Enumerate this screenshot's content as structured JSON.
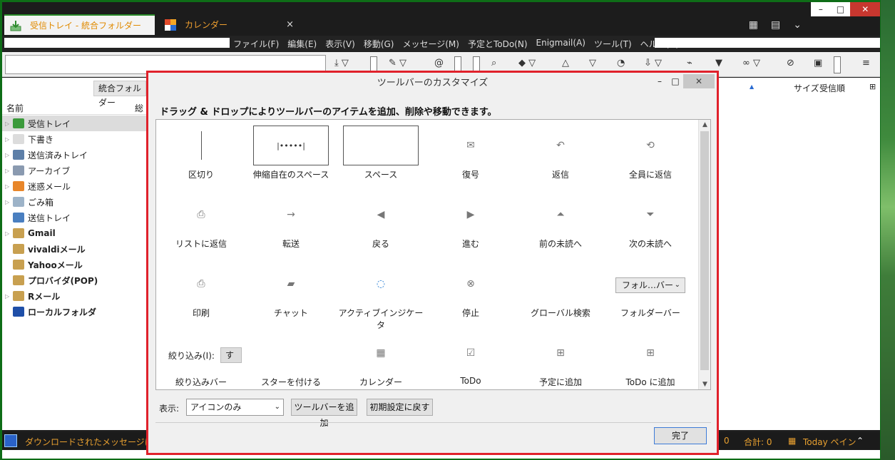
{
  "tabs": [
    {
      "label": "受信トレイ - 統合フォルダー",
      "icon": "inbox-download-icon"
    },
    {
      "label": "カレンダー",
      "icon": "calendar-icon"
    }
  ],
  "tab_close": "×",
  "window_controls": {
    "minimize": "–",
    "maximize": "□",
    "close": "✕"
  },
  "menus": [
    "ファイル(F)",
    "編集(E)",
    "表示(V)",
    "移動(G)",
    "メッセージ(M)",
    "予定とToDo(N)",
    "Enigmail(A)",
    "ツール(T)",
    "ヘルプ(H)"
  ],
  "left_pane": {
    "unified_button": "統合フォルダー",
    "col_name": "名前",
    "col_total": "総数",
    "folders": [
      {
        "label": "受信トレイ",
        "icon": "inbox-icon",
        "color": "#3b9a3b",
        "bold": false,
        "selected": true,
        "twisty": "▷"
      },
      {
        "label": "下書き",
        "icon": "draft-icon",
        "color": "#dcdcdc",
        "bold": false,
        "selected": false,
        "twisty": "▷"
      },
      {
        "label": "送信済みトレイ",
        "icon": "sent-icon",
        "color": "#5d7fa8",
        "bold": false,
        "selected": false,
        "twisty": "▷"
      },
      {
        "label": "アーカイブ",
        "icon": "archive-icon",
        "color": "#8a9ab0",
        "bold": false,
        "selected": false,
        "twisty": "▷"
      },
      {
        "label": "迷惑メール",
        "icon": "junk-icon",
        "color": "#e8862a",
        "bold": false,
        "selected": false,
        "twisty": "▷"
      },
      {
        "label": "ごみ箱",
        "icon": "trash-icon",
        "color": "#9db3c8",
        "bold": false,
        "selected": false,
        "twisty": "▷"
      },
      {
        "label": "送信トレイ",
        "icon": "outbox-icon",
        "color": "#4a7fc0",
        "bold": false,
        "selected": false,
        "twisty": ""
      },
      {
        "label": "Gmail",
        "icon": "account-icon",
        "color": "#c8a050",
        "bold": true,
        "selected": false,
        "twisty": "▷"
      },
      {
        "label": "vivaldiメール",
        "icon": "account-icon",
        "color": "#c8a050",
        "bold": true,
        "selected": false,
        "twisty": ""
      },
      {
        "label": "Yahooメール",
        "icon": "account-icon",
        "color": "#c8a050",
        "bold": true,
        "selected": false,
        "twisty": ""
      },
      {
        "label": "プロバイダ(POP)",
        "icon": "account-icon",
        "color": "#c8a050",
        "bold": true,
        "selected": false,
        "twisty": ""
      },
      {
        "label": "Rメール",
        "icon": "account-icon",
        "color": "#c8a050",
        "bold": true,
        "selected": false,
        "twisty": "▷"
      },
      {
        "label": "ローカルフォルダ",
        "icon": "local-folders-icon",
        "color": "#1f4fa8",
        "bold": true,
        "selected": false,
        "twisty": ""
      }
    ]
  },
  "right_header": {
    "sort_arrow": "▲",
    "size": "サイズ",
    "received_order": "受信順"
  },
  "dialog": {
    "title": "ツールバーのカスタマイズ",
    "instructions": "ドラッグ & ドロップによりツールバーのアイテムを追加、削除や移動できます。",
    "items": [
      {
        "label": "区切り",
        "icon": "separator-icon",
        "glyph": ""
      },
      {
        "label": "伸縮自在のスペース",
        "icon": "flexible-space-icon",
        "glyph": "|•••••|"
      },
      {
        "label": "スペース",
        "icon": "space-icon",
        "glyph": ""
      },
      {
        "label": "復号",
        "icon": "decrypt-icon",
        "glyph": "✉"
      },
      {
        "label": "返信",
        "icon": "reply-icon",
        "glyph": "↶"
      },
      {
        "label": "全員に返信",
        "icon": "reply-all-icon",
        "glyph": "⟲"
      },
      {
        "label": "リストに返信",
        "icon": "reply-list-icon",
        "glyph": "⎙"
      },
      {
        "label": "転送",
        "icon": "forward-icon",
        "glyph": "→"
      },
      {
        "label": "戻る",
        "icon": "back-icon",
        "glyph": "◀"
      },
      {
        "label": "進む",
        "icon": "forward-nav-icon",
        "glyph": "▶"
      },
      {
        "label": "前の未読へ",
        "icon": "previous-unread-icon",
        "glyph": "⏶"
      },
      {
        "label": "次の未読へ",
        "icon": "next-unread-icon",
        "glyph": "⏷"
      },
      {
        "label": "印刷",
        "icon": "print-icon",
        "glyph": "⎙"
      },
      {
        "label": "チャット",
        "icon": "chat-icon",
        "glyph": "▰"
      },
      {
        "label": "アクティブインジケータ",
        "icon": "activity-indicator-icon",
        "glyph": "◌"
      },
      {
        "label": "停止",
        "icon": "stop-icon",
        "glyph": "⊗"
      },
      {
        "label": "グローバル検索",
        "icon": "global-search-icon",
        "glyph": ""
      },
      {
        "label": "フォルダーバー",
        "icon": "folder-bar-icon",
        "glyph": ""
      },
      {
        "label": "絞り込みバー",
        "icon": "filter-bar-icon",
        "glyph": ""
      },
      {
        "label": "スターを付ける",
        "icon": "star-icon",
        "glyph": ""
      },
      {
        "label": "カレンダー",
        "icon": "calendar-icon",
        "glyph": "▦"
      },
      {
        "label": "ToDo",
        "icon": "todo-icon",
        "glyph": "☑"
      },
      {
        "label": "予定に追加",
        "icon": "add-event-icon",
        "glyph": "⊞"
      },
      {
        "label": "ToDo に追加",
        "icon": "add-todo-icon",
        "glyph": "⊞"
      }
    ],
    "folder_bar_dropdown": "フォル…バー",
    "filter_label": "絞り込み(I):",
    "filter_button": "すべて",
    "show_label": "表示:",
    "show_value": "アイコンのみ",
    "add_toolbar": "ツールバーを追加",
    "restore_default": "初期設定に戻す",
    "done": "完了"
  },
  "status": {
    "message": "ダウンロードされたメッセージはありません",
    "unread": "0",
    "total_label": "合計: 0",
    "today_pane": "Today ペイン"
  }
}
